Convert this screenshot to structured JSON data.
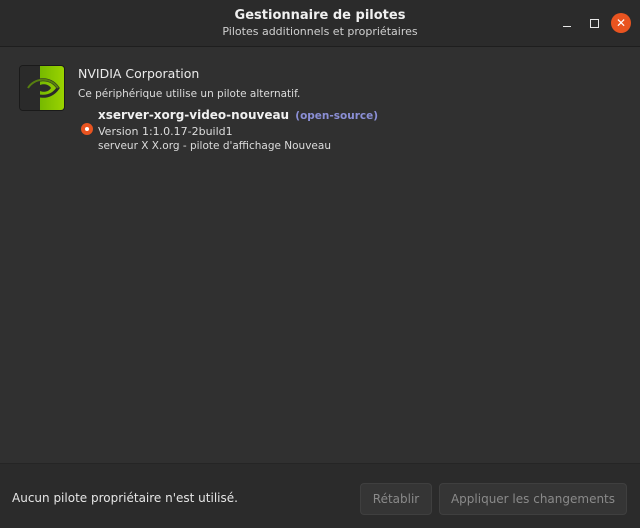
{
  "window": {
    "title": "Gestionnaire de pilotes",
    "subtitle": "Pilotes additionnels et propriétaires",
    "controls": {
      "minimize_icon": "minimize-icon",
      "maximize_icon": "maximize-icon",
      "close_icon": "close-icon",
      "close_glyph": "✕"
    }
  },
  "device": {
    "vendor": "NVIDIA Corporation",
    "description": "Ce périphérique utilise un pilote alternatif.",
    "logo_icon": "nvidia-logo-icon",
    "drivers": [
      {
        "name": "xserver-xorg-video-nouveau",
        "license": "(open-source)",
        "version": "Version 1:1.0.17-2build1",
        "description": "serveur X X.org - pilote d'affichage Nouveau",
        "selected": true
      }
    ]
  },
  "footer": {
    "status": "Aucun pilote propriétaire n'est utilisé.",
    "revert_label": "Rétablir",
    "apply_label": "Appliquer les changements"
  },
  "colors": {
    "accent": "#e95420",
    "license_link": "#8b8fd6",
    "background": "#303030"
  }
}
